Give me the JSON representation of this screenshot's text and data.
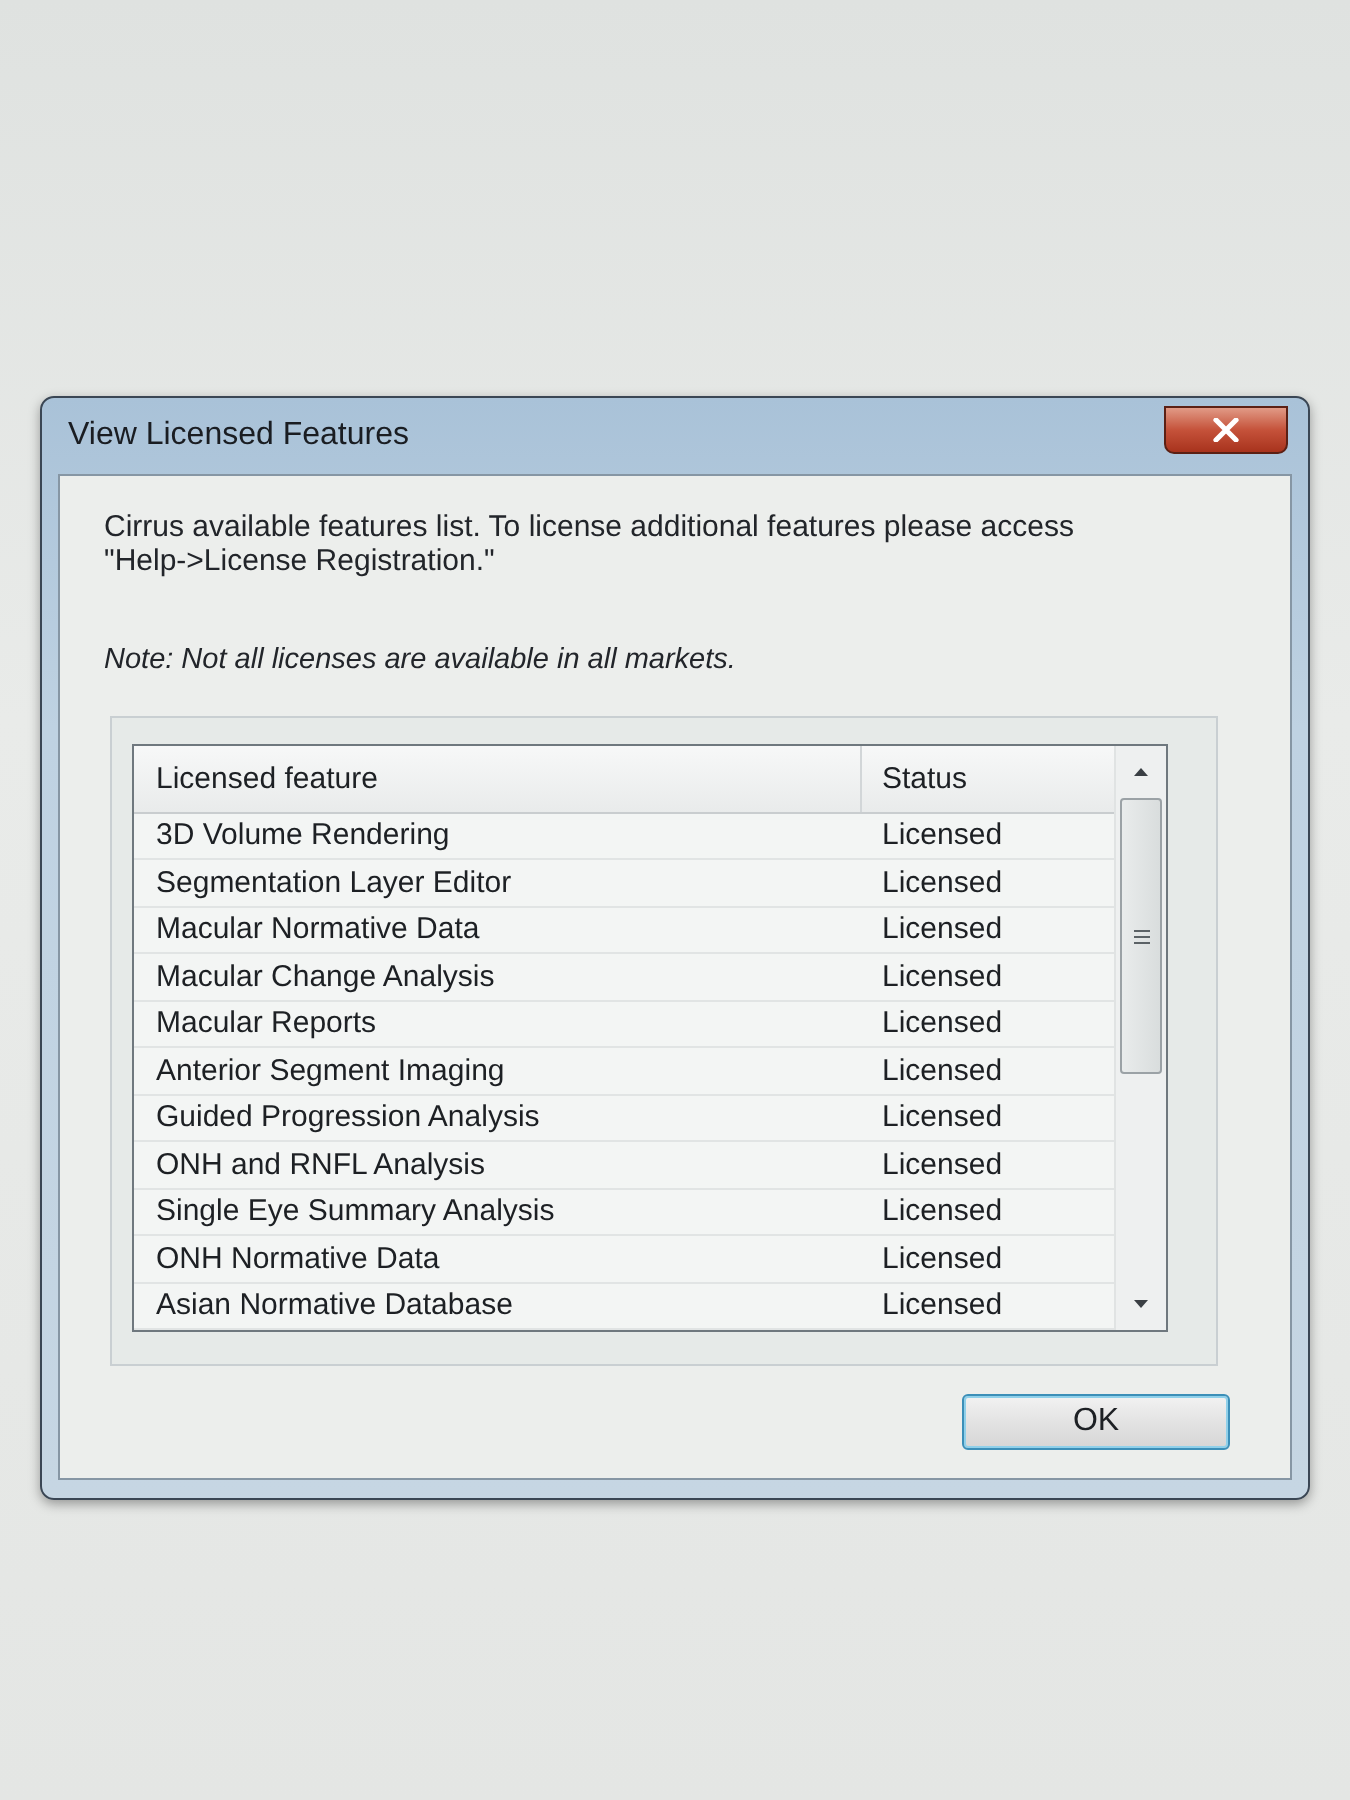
{
  "window": {
    "title": "View Licensed Features"
  },
  "description": "Cirrus available features list. To license additional features please access \"Help->License Registration.\"",
  "note": "Note: Not all licenses are available in all markets.",
  "table": {
    "columns": [
      "Licensed feature",
      "Status"
    ],
    "rows": [
      {
        "feature": "3D Volume Rendering",
        "status": "Licensed"
      },
      {
        "feature": "Segmentation Layer Editor",
        "status": "Licensed"
      },
      {
        "feature": "Macular Normative Data",
        "status": "Licensed"
      },
      {
        "feature": "Macular Change Analysis",
        "status": "Licensed"
      },
      {
        "feature": "Macular Reports",
        "status": "Licensed"
      },
      {
        "feature": "Anterior Segment Imaging",
        "status": "Licensed"
      },
      {
        "feature": "Guided Progression Analysis",
        "status": "Licensed"
      },
      {
        "feature": "ONH and RNFL Analysis",
        "status": "Licensed"
      },
      {
        "feature": "Single Eye Summary Analysis",
        "status": "Licensed"
      },
      {
        "feature": "ONH Normative Data",
        "status": "Licensed"
      },
      {
        "feature": "Asian Normative Database",
        "status": "Licensed"
      }
    ]
  },
  "buttons": [
    {
      "label": "OK",
      "focused": true
    }
  ]
}
